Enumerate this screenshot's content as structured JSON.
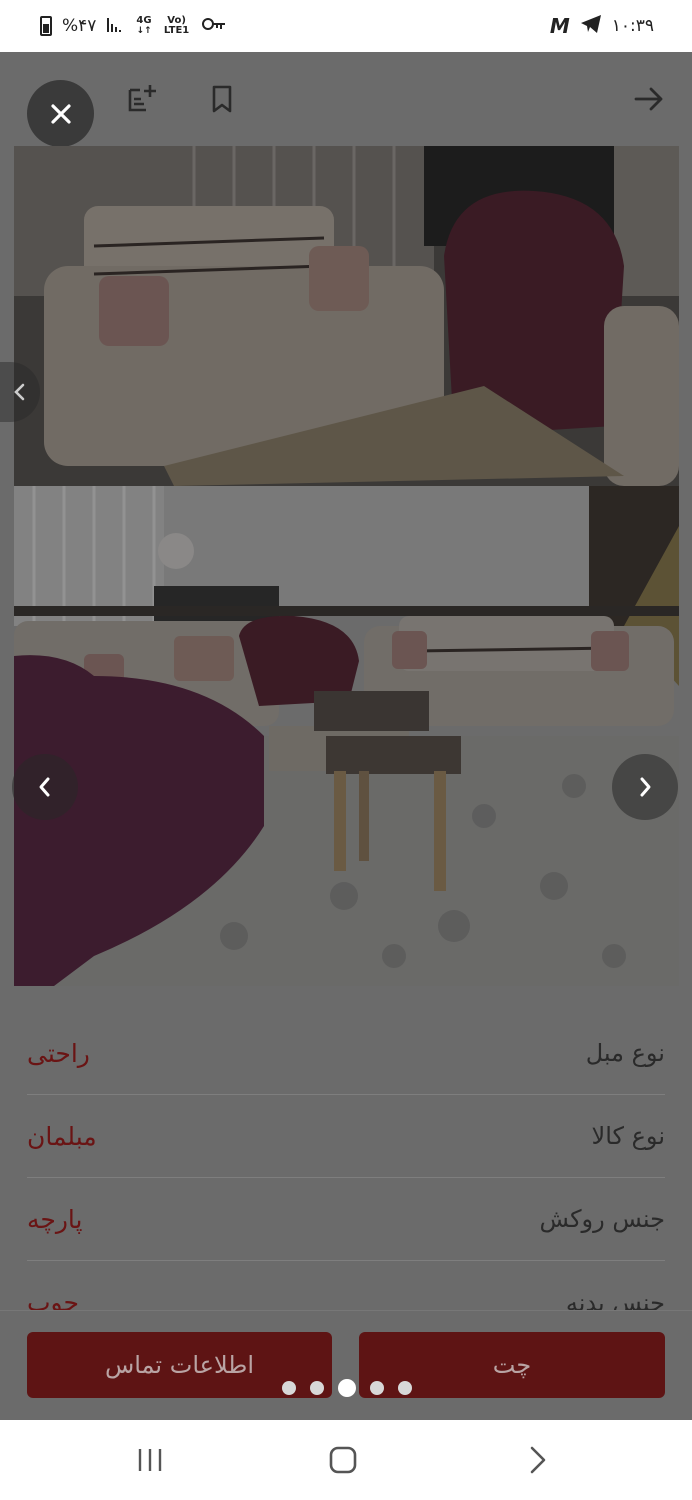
{
  "status_bar": {
    "battery": "%۴۷",
    "network_top": "4G",
    "network_bottom": "Vo) LTE1",
    "time": "۱۰:۳۹",
    "icons": [
      "battery-icon",
      "signal-icon",
      "key-icon",
      "gmail-icon",
      "telegram-icon"
    ]
  },
  "toolbar": {
    "icons": [
      "close-icon",
      "add-note-icon",
      "bookmark-icon",
      "arrow-right-icon"
    ]
  },
  "gallery": {
    "photos": [
      "sofa-photo-1",
      "sofa-photo-2"
    ]
  },
  "specs": [
    {
      "label": "نوع مبل",
      "value": "راحتی"
    },
    {
      "label": "نوع کالا",
      "value": "مبلمان"
    },
    {
      "label": "جنس روکش",
      "value": "پارچه"
    },
    {
      "label": "جنس بدنه",
      "value": "چوب"
    }
  ],
  "actions": {
    "contact_label": "اطلاعات تماس",
    "chat_label": "چت"
  },
  "pager": {
    "count": 5,
    "active_index": 2
  },
  "colors": {
    "accent": "#5e1414",
    "spec_value": "#6a1414",
    "overlay": "#6b6b6b"
  }
}
